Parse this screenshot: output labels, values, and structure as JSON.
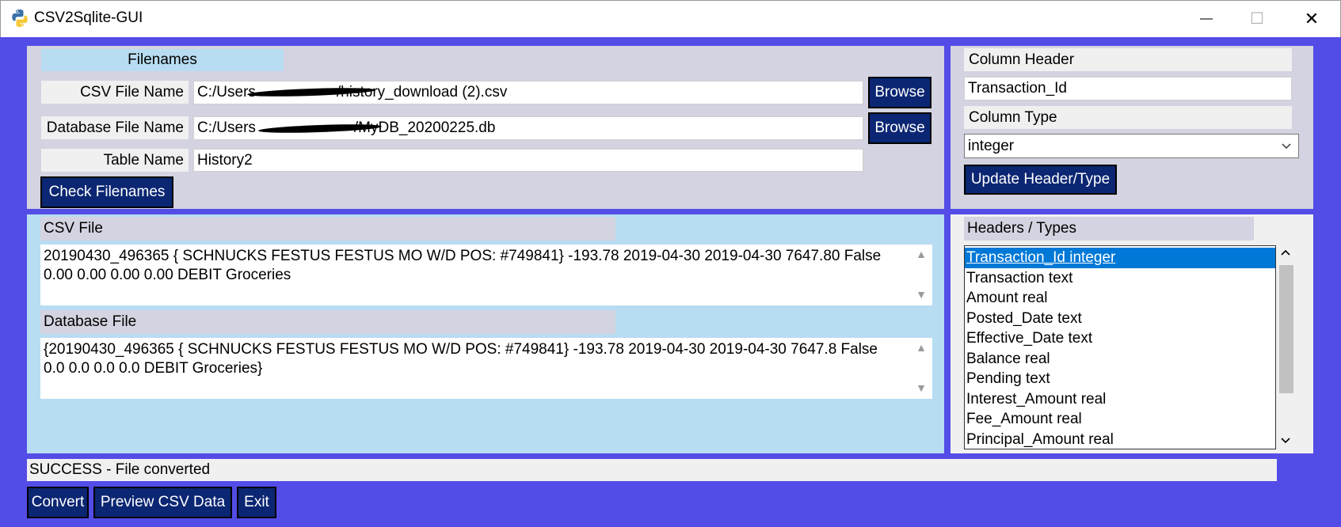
{
  "window": {
    "title": "CSV2Sqlite-GUI",
    "minimize_glyph": "—",
    "maximize_glyph": "☐",
    "close_glyph": "✕",
    "app_icon": "python-icon"
  },
  "filenames": {
    "section_label": "Filenames",
    "csv_label": "CSV File Name",
    "csv_value": "C:/Users/[redacted]/Downloads/history_download (2).csv",
    "csv_prefix": "C:/Users",
    "csv_suffix": "/history_download (2).csv",
    "db_label": "Database File Name",
    "db_prefix": "C:/Users",
    "db_suffix": "/MyDB_20200225.db",
    "table_label": "Table Name",
    "table_value": "History2",
    "browse_label": "Browse",
    "check_label": "Check Filenames"
  },
  "column": {
    "header_label": "Column Header",
    "header_value": "Transaction_Id",
    "type_label": "Column Type",
    "type_value": "integer",
    "update_label": "Update Header/Type"
  },
  "csv_file": {
    "label": "CSV File",
    "line1": "20190430_496365 { SCHNUCKS FESTUS FESTUS MO W/D POS: #749841} -193.78 2019-04-30 2019-04-30 7647.80 False",
    "line2": "0.00 0.00 0.00 0.00 DEBIT Groceries"
  },
  "db_file": {
    "label": "Database File",
    "line1": "{20190430_496365 { SCHNUCKS FESTUS FESTUS MO W/D POS: #749841} -193.78 2019-04-30 2019-04-30 7647.8 False",
    "line2": "0.0 0.0 0.0 0.0 DEBIT Groceries}"
  },
  "headers_types": {
    "label": "Headers / Types",
    "items": [
      "Transaction_Id integer",
      "Transaction text",
      "Amount real",
      "Posted_Date text",
      "Effective_Date text",
      "Balance real",
      "Pending text",
      "Interest_Amount real",
      "Fee_Amount real",
      "Principal_Amount real"
    ],
    "selected_index": 0
  },
  "status": {
    "text": "SUCCESS - File converted"
  },
  "actions": {
    "convert": "Convert",
    "preview": "Preview CSV Data",
    "exit": "Exit"
  },
  "colors": {
    "window_bg": "#534ce6",
    "panel_grey": "#d3d3e1",
    "panel_blue": "#b8dcf2",
    "button_bg": "#0b2672",
    "selection": "#0078d7"
  }
}
